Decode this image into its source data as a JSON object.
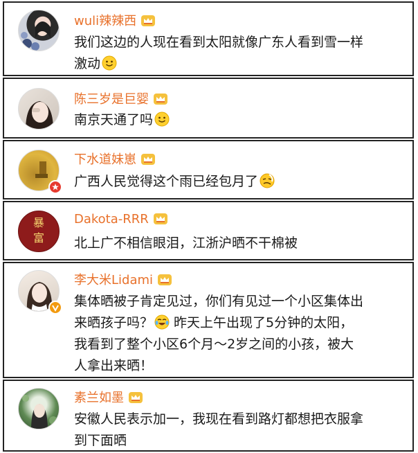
{
  "comments": [
    {
      "username": "wuli辣辣西",
      "text": "我们这边的人现在看到太阳就像广东人看到雪一样\n激动",
      "emoji": "smile",
      "crown": "crown-icon"
    },
    {
      "username": "陈三岁是巨婴",
      "text": "南京天通了吗",
      "emoji": "smile",
      "crown": "crown-icon"
    },
    {
      "username": "下水道妹崽",
      "text": "广西人民觉得这个雨已经包月了",
      "emoji": "tired",
      "crown": "crown-icon",
      "verified": "red-verified-badge"
    },
    {
      "username": "Dakota-RRR",
      "avatar_text": [
        "暴",
        "富"
      ],
      "text": "北上广不相信眼泪，江浙沪晒不干棉被",
      "crown": "crown-icon"
    },
    {
      "username": "李大米Lidami",
      "text_parts": [
        "集体晒被子肯定见过，你们有见过一个小区集体出\n来晒孩子吗？",
        " 昨天上午出现了5分钟的太阳，\n我看到了整个小区6个月～2岁之间的小孩，被大\n人拿出来晒！"
      ],
      "emoji": "laugh-cry",
      "crown": "crown-icon",
      "verified": "orange-verified-badge"
    },
    {
      "username": "素兰如墨",
      "text": "安徽人民表示加一，我现在看到路灯都想把衣服拿\n到下面晒",
      "crown": "crown-icon"
    }
  ],
  "colors": {
    "username": "#e8712b",
    "text": "#1a1a1a",
    "border": "#222222"
  }
}
